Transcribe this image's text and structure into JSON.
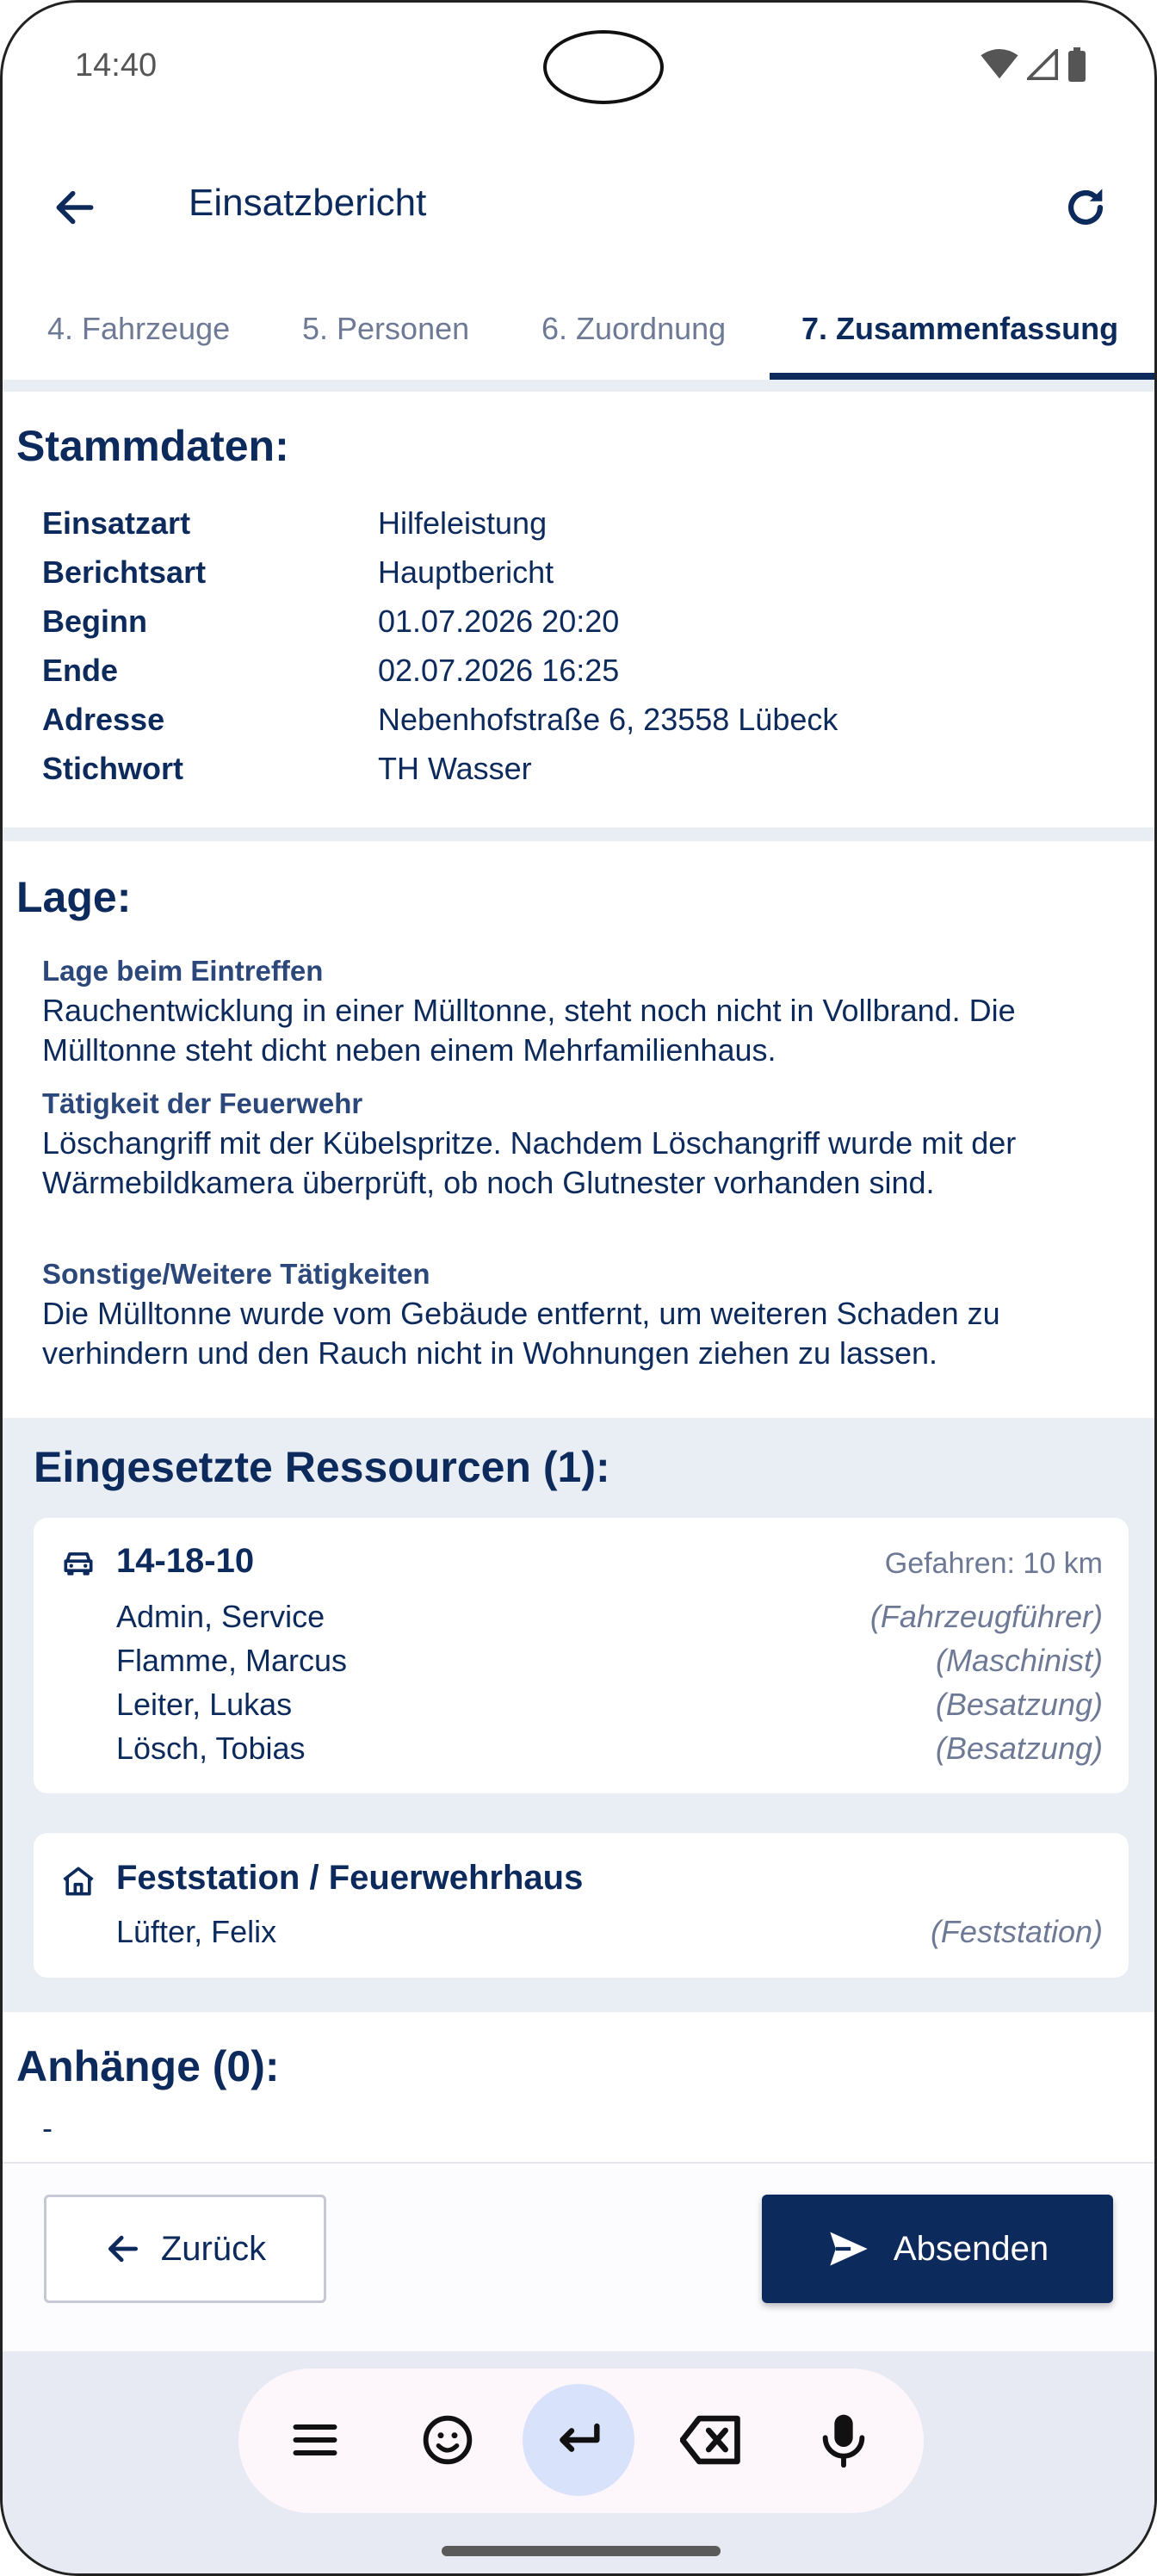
{
  "status_bar": {
    "time": "14:40"
  },
  "app_bar": {
    "title": "Einsatzbericht"
  },
  "tabs": [
    {
      "label": "4. Fahrzeuge"
    },
    {
      "label": "5. Personen"
    },
    {
      "label": "6. Zuordnung"
    },
    {
      "label": "7. Zusammenfassung",
      "active": true
    }
  ],
  "stammdaten": {
    "title": "Stammdaten:",
    "rows": [
      {
        "key": "Einsatzart",
        "value": "Hilfeleistung"
      },
      {
        "key": "Berichtsart",
        "value": "Hauptbericht"
      },
      {
        "key": "Beginn",
        "value": "01.07.2026 20:20"
      },
      {
        "key": "Ende",
        "value": "02.07.2026 16:25"
      },
      {
        "key": "Adresse",
        "value": "Nebenhofstraße 6,  23558 Lübeck"
      },
      {
        "key": "Stichwort",
        "value": "TH Wasser"
      }
    ]
  },
  "lage": {
    "title": "Lage:",
    "blocks": [
      {
        "label": "Lage beim Eintreffen",
        "text": "Rauchentwicklung in einer Mülltonne, steht noch nicht in Vollbrand. Die Mülltonne steht dicht neben einem Mehrfamilienhaus."
      },
      {
        "label": "Tätigkeit der Feuerwehr",
        "text": "Löschangriff mit der Kübelspritze. Nachdem Löschangriff wurde mit der Wärmebildkamera überprüft, ob noch Glutnester vorhanden sind."
      },
      {
        "label": "Sonstige/Weitere Tätigkeiten",
        "text": "Die Mülltonne wurde vom Gebäude entfernt, um weiteren Schaden zu verhindern und den Rauch nicht in Wohnungen ziehen zu lassen."
      }
    ]
  },
  "ressourcen": {
    "title": "Eingesetzte Ressourcen (1):",
    "vehicle": {
      "name": "14-18-10",
      "meta": "Gefahren: 10 km",
      "icon": "car-icon",
      "crew": [
        {
          "name": "Admin, Service",
          "role": "(Fahrzeugführer)"
        },
        {
          "name": "Flamme, Marcus",
          "role": "(Maschinist)"
        },
        {
          "name": "Leiter, Lukas",
          "role": "(Besatzung)"
        },
        {
          "name": "Lösch, Tobias",
          "role": "(Besatzung)"
        }
      ]
    },
    "station": {
      "name": "Feststation / Feuerwehrhaus",
      "icon": "house-icon",
      "crew": [
        {
          "name": "Lüfter, Felix",
          "role": "(Feststation)"
        }
      ]
    }
  },
  "anhaenge": {
    "title": "Anhänge (0):",
    "empty": "-"
  },
  "actions": {
    "back_label": "Zurück",
    "send_label": "Absenden"
  },
  "colors": {
    "primary": "#0d2a5c",
    "muted": "#6e7a95",
    "band": "#e9edf4"
  }
}
